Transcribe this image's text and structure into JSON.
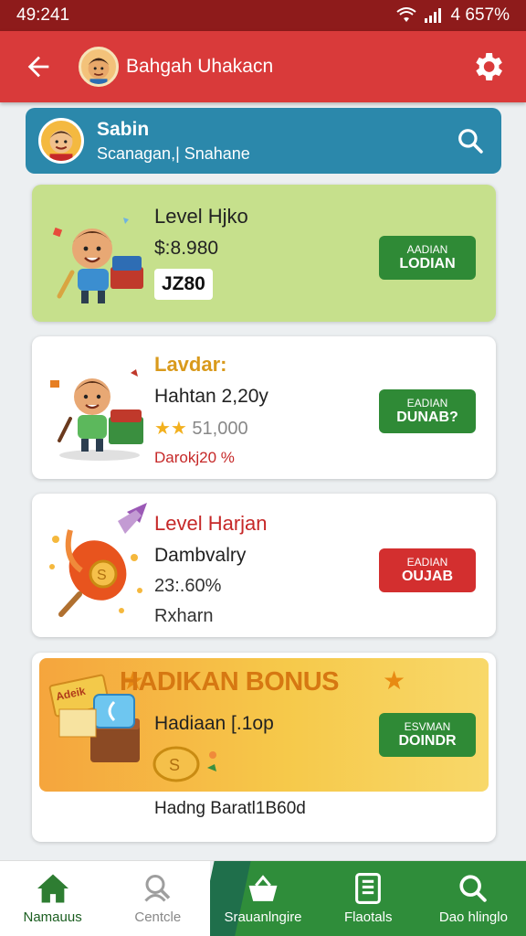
{
  "status": {
    "time": "49:241",
    "battery": "4 657%"
  },
  "appbar": {
    "title": "Bahgah Uhakacn"
  },
  "profile": {
    "name": "Sabin",
    "subtitle": "Scanagan,| Snahane"
  },
  "cards": [
    {
      "title": "Level Hjko",
      "price": "$:8.980",
      "badge": "JZ80",
      "button_small": "AADIAN",
      "button_main": "LODIAN",
      "button_color": "green"
    },
    {
      "title": "Lavdar:",
      "subtitle": "Hahtan 2,20y",
      "rating": "51,000",
      "discount": "Darokj20 %",
      "button_small": "EADIAN",
      "button_main": "DUNAB?",
      "button_color": "green"
    },
    {
      "title": "Level Harjan",
      "subtitle": "Dambvalry",
      "price": "23:.60%",
      "extra": "Rxharn",
      "button_small": "EADIAN",
      "button_main": "OUJAB",
      "button_color": "red"
    }
  ],
  "bonus": {
    "title": "HADIKAN BONUS",
    "subtitle": "Hadiaan [.1op",
    "button_small": "ESVMAN",
    "button_main": "DOINDR",
    "footer": "Hadng Baratl1B60d",
    "chest_label": "Adeik"
  },
  "nav": [
    {
      "label": "Namauus",
      "icon": "home-icon"
    },
    {
      "label": "Centcle",
      "icon": "user-search-icon"
    },
    {
      "label": "Srauanlngire",
      "icon": "basket-icon"
    },
    {
      "label": "Flaotals",
      "icon": "notes-icon"
    },
    {
      "label": "Dao hlinglo",
      "icon": "search-icon"
    }
  ],
  "colors": {
    "appbar": "#d93a3a",
    "statusbar": "#8e1b1b",
    "profile": "#2b88ab",
    "green_button": "#2f8a36",
    "red_button": "#d32f2f",
    "nav_active": "#2f8d3a"
  }
}
